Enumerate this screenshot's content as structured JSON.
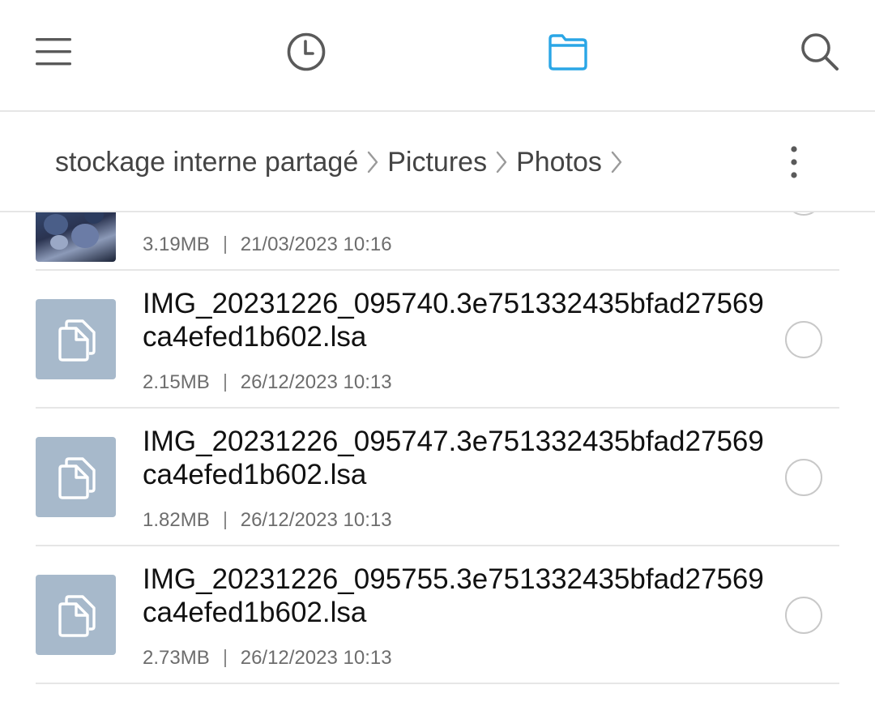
{
  "toolbar": {
    "icons": [
      "menu-icon",
      "history-icon",
      "folder-icon",
      "search-icon"
    ],
    "active_tab": "folder",
    "accent_color": "#2aa6e6",
    "icon_color": "#5a5a5a"
  },
  "breadcrumb": {
    "items": [
      "stockage interne partagé",
      "Pictures",
      "Photos"
    ],
    "overflow_icon": "more-vertical-icon"
  },
  "files": [
    {
      "name": "",
      "size": "3.19MB",
      "date": "21/03/2023 10:16",
      "thumbnail": "photo"
    },
    {
      "name": "IMG_20231226_095740.3e751332435bfad27569ca4efed1b602.lsa",
      "size": "2.15MB",
      "date": "26/12/2023 10:13",
      "thumbnail": "document-icon"
    },
    {
      "name": "IMG_20231226_095747.3e751332435bfad27569ca4efed1b602.lsa",
      "size": "1.82MB",
      "date": "26/12/2023 10:13",
      "thumbnail": "document-icon"
    },
    {
      "name": "IMG_20231226_095755.3e751332435bfad27569ca4efed1b602.lsa",
      "size": "2.73MB",
      "date": "26/12/2023 10:13",
      "thumbnail": "document-icon"
    }
  ]
}
